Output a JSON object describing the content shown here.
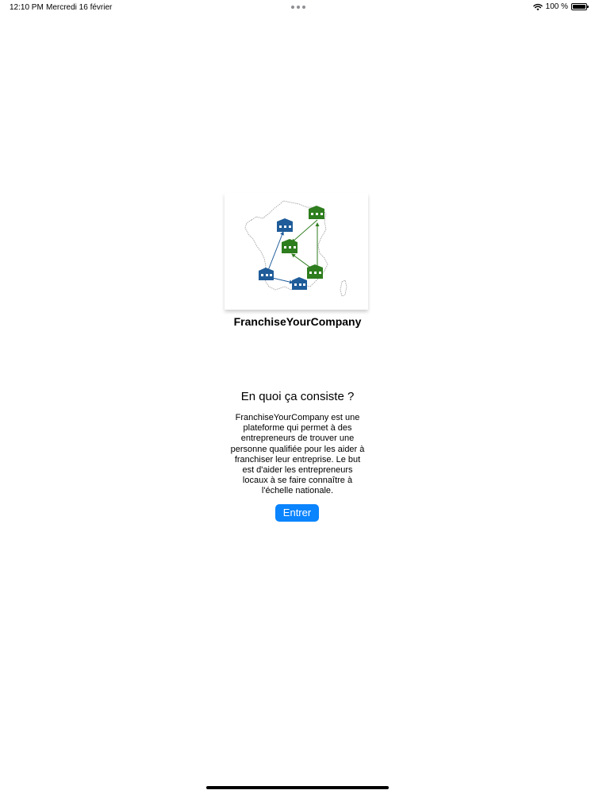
{
  "status_bar": {
    "time": "12:10 PM",
    "date": "Mercredi 16 février",
    "battery": "100 %",
    "battery_level": 1.0,
    "icons": [
      "wifi-icon",
      "battery-icon",
      "multitasking-dots-icon"
    ]
  },
  "app": {
    "brand": "FranchiseYourCompany",
    "logo_icon": "france-map-franchise-icon"
  },
  "main": {
    "heading": "En quoi ça consiste ?",
    "description": "FranchiseYourCompany est une plateforme qui permet à des entrepreneurs de trouver une personne qualifiée pour les aider à franchiser leur entreprise. Le but est d'aider les entrepreneurs locaux à se faire connaître à l'échelle nationale.",
    "enter_label": "Entrer"
  },
  "colors": {
    "accent": "#0a84ff",
    "logo_green": "#2e7d1e",
    "logo_blue": "#1f5c99"
  }
}
